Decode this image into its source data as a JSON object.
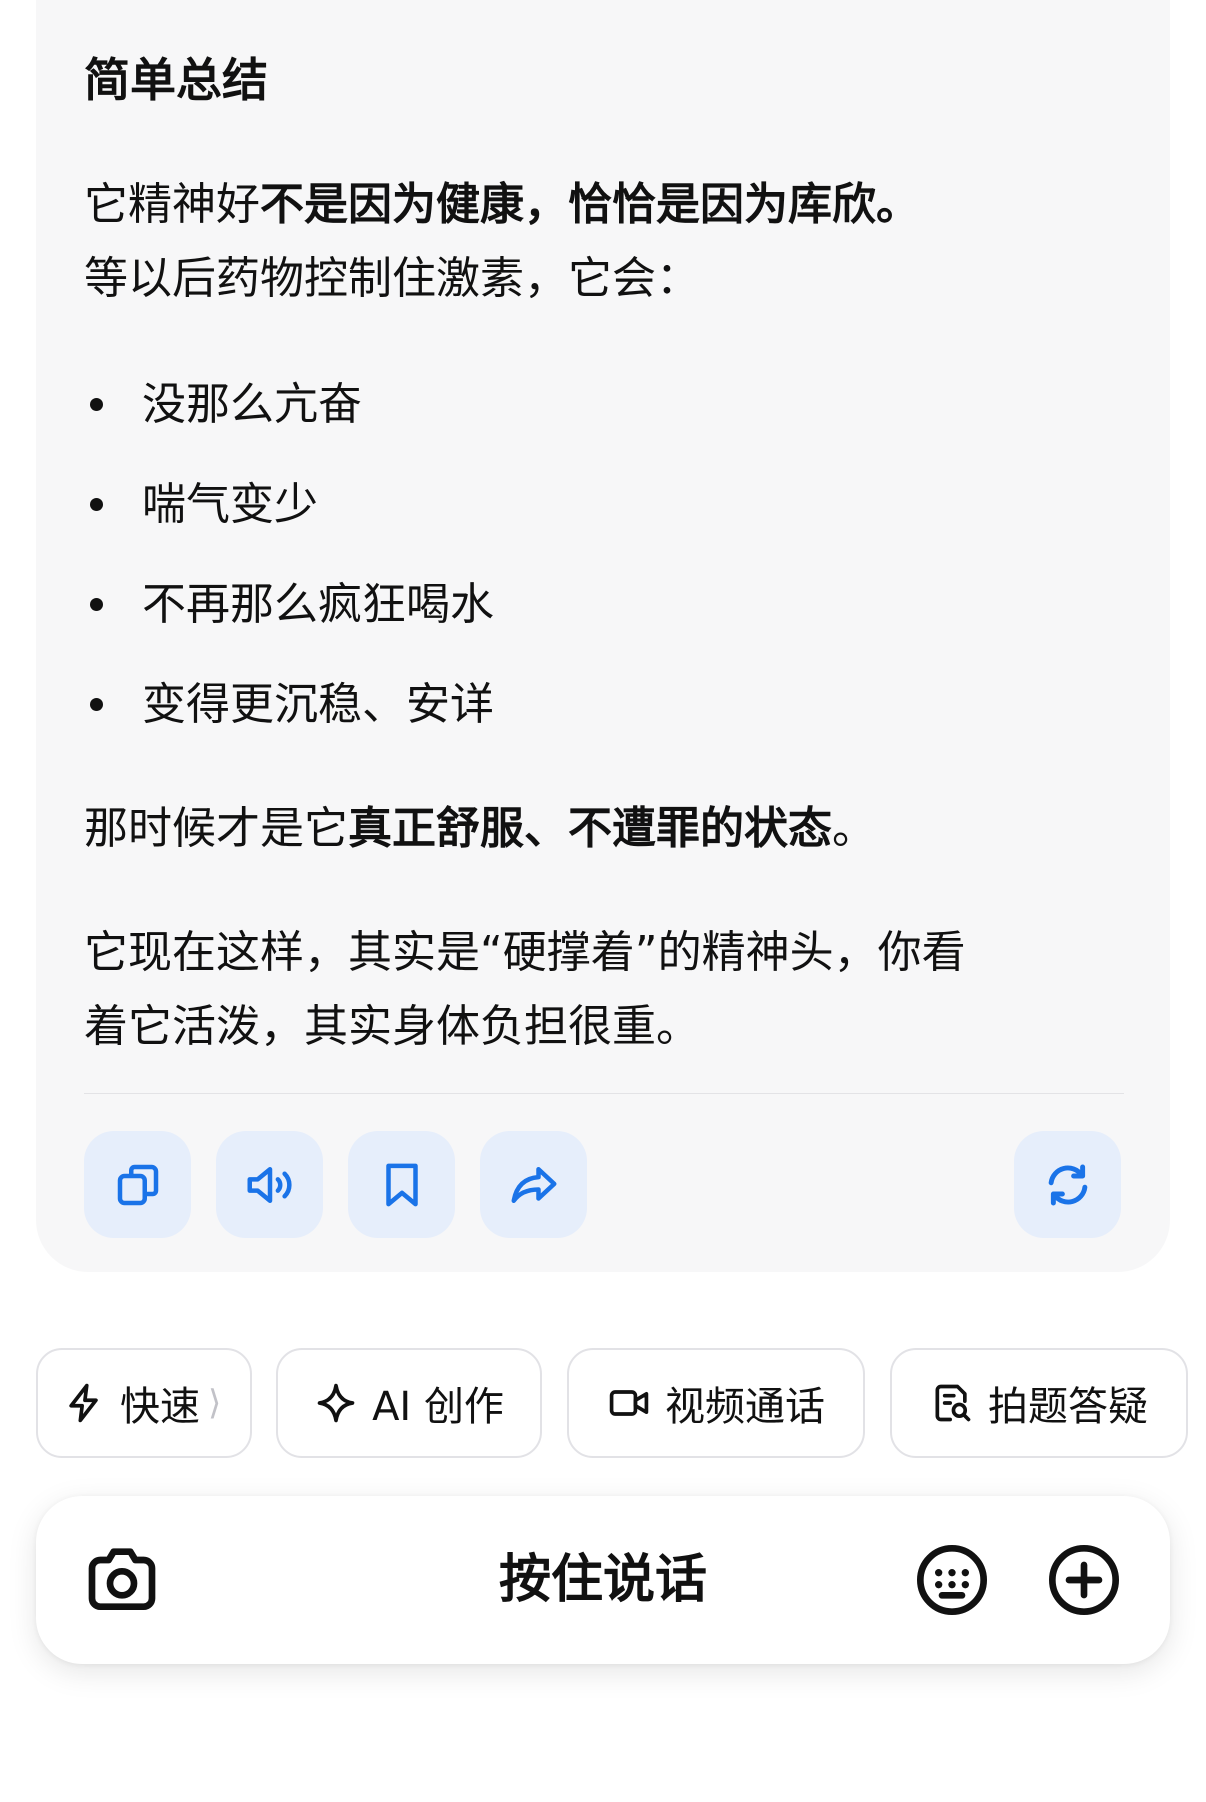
{
  "message": {
    "heading": "简单总结",
    "intro": {
      "line1_a": "它精神好",
      "line1_b": "不是因为健康，恰恰是因为库欣。",
      "line2": "等以后药物控制住激素，它会："
    },
    "bullets": [
      "没那么亢奋",
      "喘气变少",
      "不再那么疯狂喝水",
      "变得更沉稳、安详"
    ],
    "para2": {
      "a": "那时候才是它",
      "b": "真正舒服、不遭罪的状态",
      "c": "。"
    },
    "para3": {
      "line1": "它现在这样，其实是“硬撑着”的精神头，你看",
      "line2": "着它活泼，其实身体负担很重。"
    }
  },
  "actions": {
    "icons": [
      "copy-icon",
      "speaker-icon",
      "bookmark-icon",
      "share-icon",
      "refresh-icon"
    ],
    "accent": "#1a73e8",
    "bg": "#e6eefb"
  },
  "chips": [
    {
      "label": "快速",
      "icon": "lightning-icon"
    },
    {
      "label": "AI 创作",
      "icon": "sparkle-icon"
    },
    {
      "label": "视频通话",
      "icon": "video-camera-icon"
    },
    {
      "label": "拍题答疑",
      "icon": "document-search-icon"
    }
  ],
  "input_bar": {
    "label": "按住说话",
    "icons": [
      "camera-icon",
      "keyboard-icon",
      "plus-icon"
    ]
  }
}
